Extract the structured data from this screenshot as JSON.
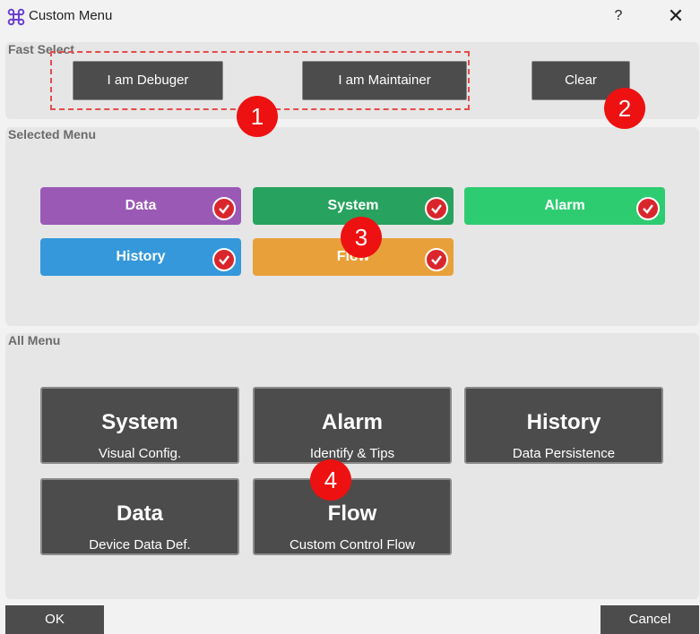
{
  "window": {
    "title": "Custom Menu",
    "help_label": "?",
    "close_label": "✕"
  },
  "fast_select": {
    "title": "Fast Select",
    "debuger_label": "I am Debuger",
    "maintainer_label": "I am Maintainer",
    "clear_label": "Clear"
  },
  "selected_menu": {
    "title": "Selected Menu",
    "items": [
      {
        "label": "Data",
        "color": "#9b59b6"
      },
      {
        "label": "System",
        "color": "#27a35f"
      },
      {
        "label": "Alarm",
        "color": "#2ecc71"
      },
      {
        "label": "History",
        "color": "#3498db"
      },
      {
        "label": "Flow",
        "color": "#e8a13a"
      }
    ]
  },
  "all_menu": {
    "title": "All Menu",
    "tiles": [
      {
        "title": "System",
        "subtitle": "Visual Config."
      },
      {
        "title": "Alarm",
        "subtitle": "Identify & Tips"
      },
      {
        "title": "History",
        "subtitle": "Data Persistence"
      },
      {
        "title": "Data",
        "subtitle": "Device Data Def."
      },
      {
        "title": "Flow",
        "subtitle": "Custom Control Flow"
      }
    ]
  },
  "badges": [
    "1",
    "2",
    "3",
    "4"
  ],
  "footer": {
    "ok_label": "OK",
    "cancel_label": "Cancel"
  },
  "colors": {
    "badge": "#ee1111",
    "button": "#4c4c4c",
    "panel": "#e6e6e6"
  }
}
